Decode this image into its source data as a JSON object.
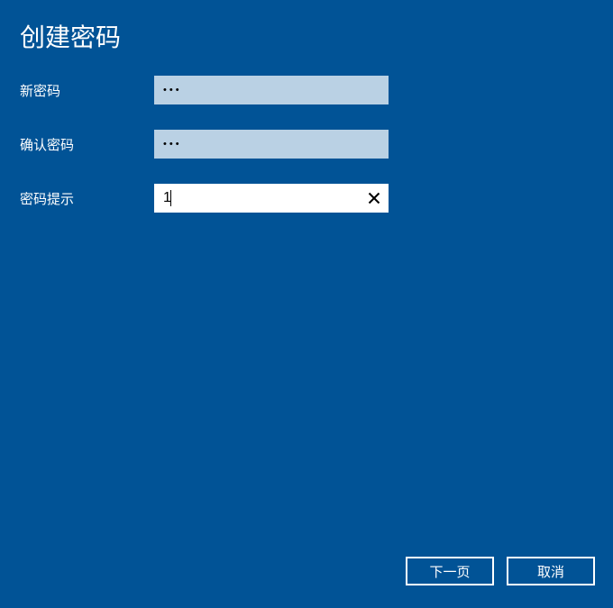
{
  "title": "创建密码",
  "fields": {
    "newPassword": {
      "label": "新密码",
      "value": "•••"
    },
    "confirmPassword": {
      "label": "确认密码",
      "value": "•••"
    },
    "passwordHint": {
      "label": "密码提示",
      "value": "1"
    }
  },
  "buttons": {
    "next": "下一页",
    "cancel": "取消"
  },
  "colors": {
    "background": "#015396",
    "inputFilled": "#bad1e4",
    "inputActive": "#ffffff"
  }
}
